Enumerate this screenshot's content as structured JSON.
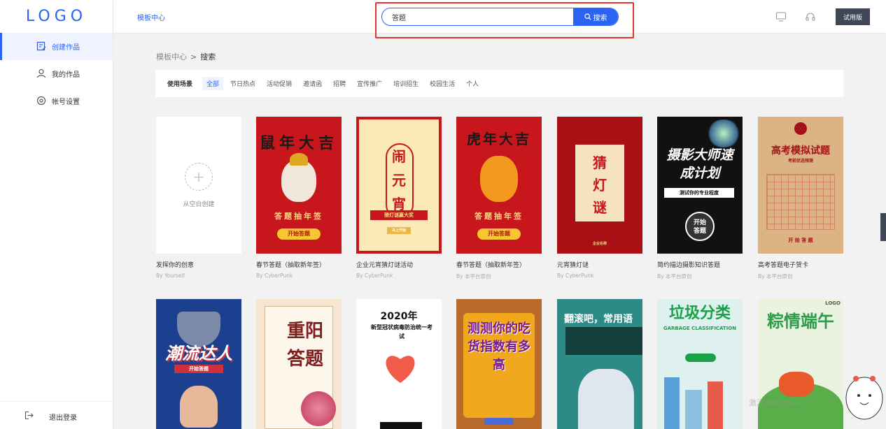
{
  "sidebar": {
    "logo": "LOGO",
    "items": [
      {
        "label": "创建作品",
        "icon": "edit-icon",
        "active": true
      },
      {
        "label": "我的作品",
        "icon": "user-icon",
        "active": false
      },
      {
        "label": "帐号设置",
        "icon": "settings-icon",
        "active": false
      }
    ],
    "logout": "退出登录"
  },
  "header": {
    "link": "模板中心",
    "search_value": "答题",
    "search_button": "搜索",
    "trial_button": "试用版"
  },
  "breadcrumb": {
    "parent": "模板中心",
    "separator": ">",
    "current": "搜索"
  },
  "filter": {
    "label": "使用场景",
    "options": [
      "全部",
      "节日热点",
      "活动促销",
      "邀请函",
      "招聘",
      "宣传推广",
      "培训招生",
      "校园生活",
      "个人"
    ]
  },
  "blank_card": {
    "label": "从空白创建",
    "title": "发挥你的创意",
    "author": "By Yourself"
  },
  "cards": [
    {
      "title": "春节答题（抽取新年签）",
      "author": "By CyberPunk",
      "poster": "鼠年大吉",
      "sub": "答题抽年签",
      "btn": "开始答题"
    },
    {
      "title": "企业元宵猜灯谜活动",
      "author": "By CyberPunk",
      "poster": "闹元宵",
      "sub": "猜灯谜赢大奖",
      "btn": "马上开始"
    },
    {
      "title": "春节答题（抽取新年签）",
      "author": "By 本平台原创",
      "poster": "虎年大吉",
      "sub": "答题抽年签",
      "btn": "开始答题"
    },
    {
      "title": "元宵猜灯谜",
      "author": "By CyberPunk",
      "poster": "猜灯谜",
      "sub": "",
      "btn": "企业名称"
    },
    {
      "title": "简约描边摄影知识答题",
      "author": "By 本平台原创",
      "poster": "摄影大师速成计划",
      "sub": "测试你的专业程度",
      "btn": "开始答题"
    },
    {
      "title": "高考答题电子贺卡",
      "author": "By 本平台原创",
      "poster": "高考模拟试题",
      "sub": "考前优选预测",
      "btn": "开 始 答 题"
    }
  ],
  "row2": [
    {
      "poster": "潮流达人",
      "sub": "开始答题"
    },
    {
      "poster": "重阳答题",
      "sub": ""
    },
    {
      "poster": "2020年",
      "sub": "新型冠状病毒防治统一考试"
    },
    {
      "poster": "测测你的吃货指数有多高",
      "sub": ""
    },
    {
      "poster": "翻滚吧，常用语",
      "sub": ""
    },
    {
      "poster": "垃圾分类",
      "sub": "GARBAGE CLASSIFICATION"
    },
    {
      "poster": "粽情端午",
      "sub": "LOGO"
    }
  ],
  "colors": {
    "accent": "#2b63f5",
    "highlight_border": "#e5322d",
    "trial_bg": "#3f4656"
  }
}
